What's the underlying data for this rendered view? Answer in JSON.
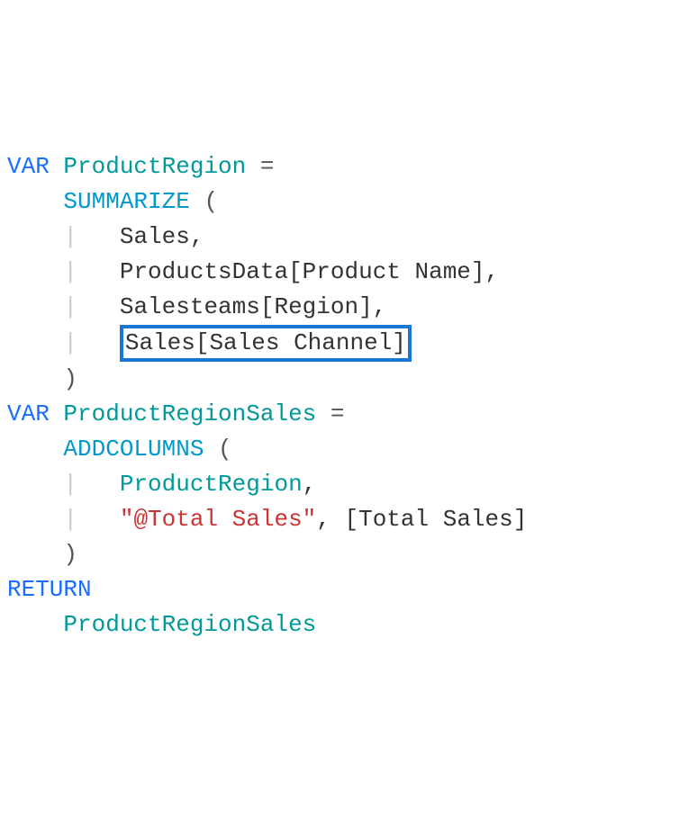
{
  "code": {
    "var_keyword": "VAR",
    "return_keyword": "RETURN",
    "var1_name": "ProductRegion",
    "var2_name": "ProductRegionSales",
    "func1": "SUMMARIZE",
    "func2": "ADDCOLUMNS",
    "arg_sales": "Sales",
    "arg_productsdata_col": "ProductsData[Product Name]",
    "arg_salesteams_col": "Salesteams[Region]",
    "arg_sales_channel": "Sales[Sales Channel]",
    "arg_productregion": "ProductRegion",
    "arg_total_sales_label": "\"@Total Sales\"",
    "arg_total_sales_measure": "[Total Sales]",
    "return_expr": "ProductRegionSales",
    "eq": " =",
    "open_paren": " (",
    "close_paren": ")",
    "comma": ","
  }
}
